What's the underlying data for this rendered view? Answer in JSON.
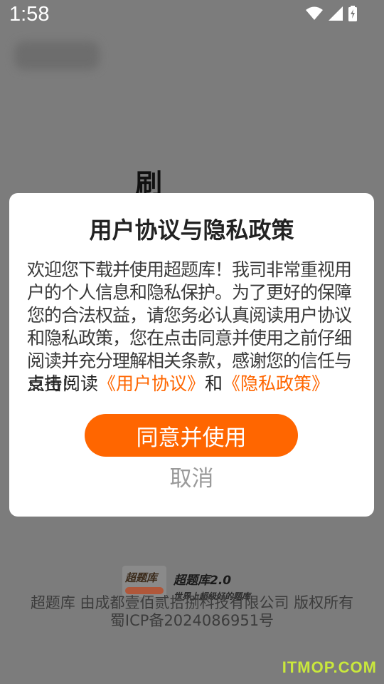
{
  "status_bar": {
    "time": "1:58",
    "icons": [
      "wifi-icon",
      "signal-icon",
      "battery-icon"
    ]
  },
  "background": {
    "partial_char": "刷"
  },
  "dialog": {
    "title": "用户协议与隐私政策",
    "body": "欢迎您下载并使用超题库！我司非常重视用户的个人信息和隐私保护。为了更好的保障您的合法权益，请您务必认真阅读用户协议和隐私政策，您在点击同意并使用之前仔细阅读并充分理解相关条款，感谢您的信任与支持！",
    "links_prefix": "点击阅读",
    "user_agreement_link": "《用户协议》",
    "links_and": "和",
    "privacy_policy_link": "《隐私政策》",
    "agree_button": "同意并使用",
    "cancel_button": "取消"
  },
  "footer": {
    "logo_text": "超题库",
    "brand": "超题库2.0",
    "slogan": "世界上超级好的题库",
    "copyright_line1": "超题库 由成都壹佰贰拾捌科技有限公司 版权所有",
    "copyright_line2": "蜀ICP备2024086951号"
  },
  "watermark": "ITMOP.COM",
  "colors": {
    "accent": "#ff6600",
    "overlay": "#7c7c7c",
    "cancel_text": "#9a9a9a"
  }
}
